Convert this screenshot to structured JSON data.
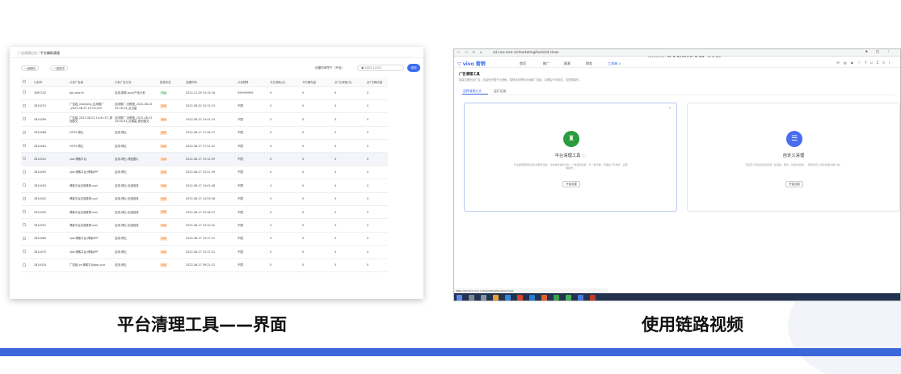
{
  "captions": {
    "left": "平台清理工具——界面",
    "right": "使用链路视频"
  },
  "left": {
    "breadcrumb_parent": "广告清理后台",
    "breadcrumb_sep": " / ",
    "breadcrumb_current": "平台辅助清理",
    "btn1": "一键删除",
    "btn2": "一键暂停",
    "filter_label": "创建时间早于（不含）",
    "date_value": "2022-12-02",
    "query": "查询",
    "columns": [
      "",
      "计划ID",
      "计划广告组",
      "计划广告计划",
      "投放状态",
      "创建时间",
      "计划预算",
      "今日消耗(元)",
      "今日曝光量",
      "近7日消耗(元)",
      "近7日曝光量"
    ],
    "rows": [
      {
        "id": "3487232",
        "group": "dpi-search",
        "plan": "应用-推荐-push产品计划",
        "status": "开启",
        "status_color": "green",
        "created": "2022-11-09 10:15:18",
        "budget": "999999999",
        "c1": "0",
        "c2": "0",
        "c3": "0",
        "c4": "0"
      },
      {
        "id": "2814231",
        "group": "广告组_xiaoyang_应用推广_2022-08-22 15:15:240",
        "plan": "应用推广-全覆盖_2022-08-22 15:16:33_点击量",
        "status": "暂停",
        "status_color": "orange",
        "created": "2022-08-22 15:12:13",
        "budget": "不限",
        "c1": "0",
        "c2": "0",
        "c3": "0",
        "c4": "0"
      },
      {
        "id": "2814099",
        "group": "广告组_2022-08-22 14:41:07_原创图文",
        "plan": "应用推广-全覆盖_2022-08-22 14:44:01_点播量_原创图文",
        "status": "暂停",
        "status_color": "orange",
        "created": "2022-08-22 14:41:19",
        "budget": "不限",
        "c1": "0",
        "c2": "0",
        "c3": "0",
        "c4": "0"
      },
      {
        "id": "2814066",
        "group": "OCPX-博云",
        "plan": "应用-博云",
        "status": "暂停",
        "status_color": "orange",
        "created": "2022-08-17 17:44:27",
        "budget": "不限",
        "c1": "0",
        "c2": "0",
        "c3": "0",
        "c4": "0"
      },
      {
        "id": "2814061",
        "group": "OCPX-博云",
        "plan": "应用-博云",
        "status": "暂停",
        "status_color": "orange",
        "created": "2022-08-17 17:21:01",
        "budget": "不限",
        "c1": "0",
        "c2": "0",
        "c3": "0",
        "c4": "0"
      },
      {
        "id": "2814041",
        "group": "cpd-博客平台",
        "plan": "应用-博云-博蓝图片",
        "status": "暂停",
        "status_color": "orange",
        "created": "2022-08-17 15:12:59",
        "budget": "不限",
        "c1": "0",
        "c2": "0",
        "c3": "0",
        "c4": "0",
        "hl": true
      },
      {
        "id": "2814005",
        "group": "cpd-博客平台-博客APP",
        "plan": "应用-博云",
        "status": "暂停",
        "status_color": "orange",
        "created": "2022-08-17 15:21:39",
        "budget": "不限",
        "c1": "0",
        "c2": "0",
        "c3": "0",
        "c4": "0"
      },
      {
        "id": "2814003",
        "group": "博客平台应用推荐-cpd",
        "plan": "应用-博云-优选投放",
        "status": "暂停",
        "status_color": "orange",
        "created": "2022-08-17 14:01:48",
        "budget": "不限",
        "c1": "0",
        "c2": "0",
        "c3": "0",
        "c4": "0"
      },
      {
        "id": "2814002",
        "group": "博客平台应用推荐-cpd",
        "plan": "应用-博云-优选投放",
        "status": "暂停",
        "status_color": "orange",
        "created": "2022-08-17 14:53:56",
        "budget": "不限",
        "c1": "0",
        "c2": "0",
        "c3": "0",
        "c4": "0"
      },
      {
        "id": "2814000",
        "group": "博客平台应用推荐-cpd",
        "plan": "应用-博云-优选投放",
        "status": "暂停",
        "status_color": "orange",
        "created": "2022-08-17 15:26:27",
        "budget": "不限",
        "c1": "0",
        "c2": "0",
        "c3": "0",
        "c4": "0"
      },
      {
        "id": "2814001",
        "group": "博客平台应用推荐-cpd",
        "plan": "应用-博云-优选投放",
        "status": "暂停",
        "status_color": "orange",
        "created": "2022-08-17 15:22:41",
        "budget": "不限",
        "c1": "0",
        "c2": "0",
        "c3": "0",
        "c4": "0"
      },
      {
        "id": "2814080",
        "group": "cpd-博客平台-博客APP",
        "plan": "应用-博云",
        "status": "暂停",
        "status_color": "orange",
        "created": "2022-08-17 15:17:21",
        "budget": "不限",
        "c1": "0",
        "c2": "0",
        "c3": "0",
        "c4": "0"
      },
      {
        "id": "2814070",
        "group": "cpd-博客平台-博客APP",
        "plan": "应用-博云",
        "status": "暂停",
        "status_color": "orange",
        "created": "2022-08-17 15:17:21",
        "budget": "不限",
        "c1": "0",
        "c2": "0",
        "c3": "0",
        "c4": "0"
      },
      {
        "id": "2814024",
        "group": "广告组-vs-博客平台app-cpd",
        "plan": "应用-博云",
        "status": "暂停",
        "status_color": "orange",
        "created": "2022-08-17 09:21:21",
        "budget": "不限",
        "c1": "0",
        "c2": "0",
        "c3": "0",
        "c4": "0"
      }
    ]
  },
  "right": {
    "url": "ad.vivo.com.cn/marketing/tools/ad-clean",
    "watermark": "www.BANDICAM.com",
    "logo": "vivo 营销",
    "nav": [
      "首页",
      "推广",
      "报表",
      "财务",
      "工具箱 ∨"
    ],
    "user": "YuZhi",
    "page_title": "广告清理工具",
    "page_desc": "批量清理无效广告，包括但不限于无消耗、暂停状态等的计划和广告组，清理后不可恢复，请谨慎操作。",
    "tabs": [
      "选择清理方式",
      "运行记录"
    ],
    "card1": {
      "name": "平台清理工具",
      "info": "ⓘ",
      "desc": "平台按照规则筛选出长期无消耗、无效或暂停的计划、广告组和创意，可一键清理，清理后不可恢复，请谨慎操作。",
      "btn": "开始创建"
    },
    "card2": {
      "name": "自定义清理",
      "desc": "可自定义筛选条件和范围（如消耗、曝光、创建时间等），按照自定义条件批量清理广告。",
      "btn": "开始创建"
    },
    "status_url": "https://ad.vivo.com.cn/marketing/tools/ad-clean"
  },
  "colors": {
    "accent": "#3b67d8",
    "green_icon": "#2a9c3e",
    "blue_icon": "#4a6cf0"
  }
}
